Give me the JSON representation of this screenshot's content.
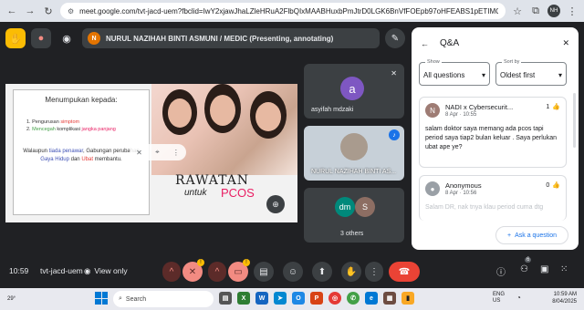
{
  "browser": {
    "url": "meet.google.com/tvt-jacd-uem?fbclid=IwY2xjawJhaLZleHRuA2FlbQIxMAABHuxbPmJtrD0LGK6BnVfFOEpb97oHFEABS1pETIMQeAYsfVTsp1LujHxaqCew...",
    "profile_initials": "NH"
  },
  "meet": {
    "presenter_initial": "N",
    "presenting_text": "NURUL NAZIHAH BINTI ASMUNI / MEDIC (Presenting, annotating)",
    "time": "10:59",
    "meeting_code": "tvt-jacd-uem",
    "view_only_label": "View only",
    "people_count": "6"
  },
  "slide": {
    "heading": "Menumpukan kepada:",
    "list": [
      {
        "prefix": "1. Pengurusan ",
        "highlight": "simptom",
        "suffix": ""
      },
      {
        "prefix": "2. ",
        "highlight": "Mencegah",
        "suffix": " komplikasi ",
        "highlight2": "jangka panjang"
      }
    ],
    "para_1": "Walaupun ",
    "para_1_hl": "tiada penawar",
    "para_2": ", Gabungan perubahan ",
    "para_2_hl": "Gaya Hidup",
    "para_3": " dan ",
    "para_3_hl": "Ubat",
    "para_4": " membantu.",
    "title_1": "RAWATAN",
    "title_2": "untuk",
    "title_3": "PCOS"
  },
  "participants": [
    {
      "initial": "a",
      "name": "asyifah mdzaki"
    },
    {
      "name": "NURUL NAZIHAH BINTI AS..."
    },
    {
      "initial_1": "dm",
      "initial_2": "S",
      "label": "3 others"
    }
  ],
  "qa": {
    "title": "Q&A",
    "show_label": "Show",
    "show_value": "All questions",
    "sort_label": "Sort by",
    "sort_value": "Oldest first",
    "questions": [
      {
        "initial": "N",
        "author": "NADI x Cybersecurit...",
        "time": "8 Apr · 10:55",
        "votes": "1",
        "text": "salam doktor saya memang ada pcos tapi period saya tiap2 bulan keluar . Saya perlukan ubat ape ye?"
      },
      {
        "initial": "",
        "author": "Anonymous",
        "time": "8 Apr · 10:56",
        "votes": "0",
        "text": "Salam DR, nak tnya klau period cuma dtg"
      }
    ],
    "ask_label": "Ask a question"
  },
  "taskbar": {
    "weather": "29°",
    "search_placeholder": "Search",
    "lang_1": "ENG",
    "lang_2": "US",
    "clock_time": "10:59 AM",
    "clock_date": "8/04/2025"
  },
  "colors": {
    "meet_bg": "#202124",
    "end_call": "#ea4335",
    "accent": "#1a73e8"
  }
}
